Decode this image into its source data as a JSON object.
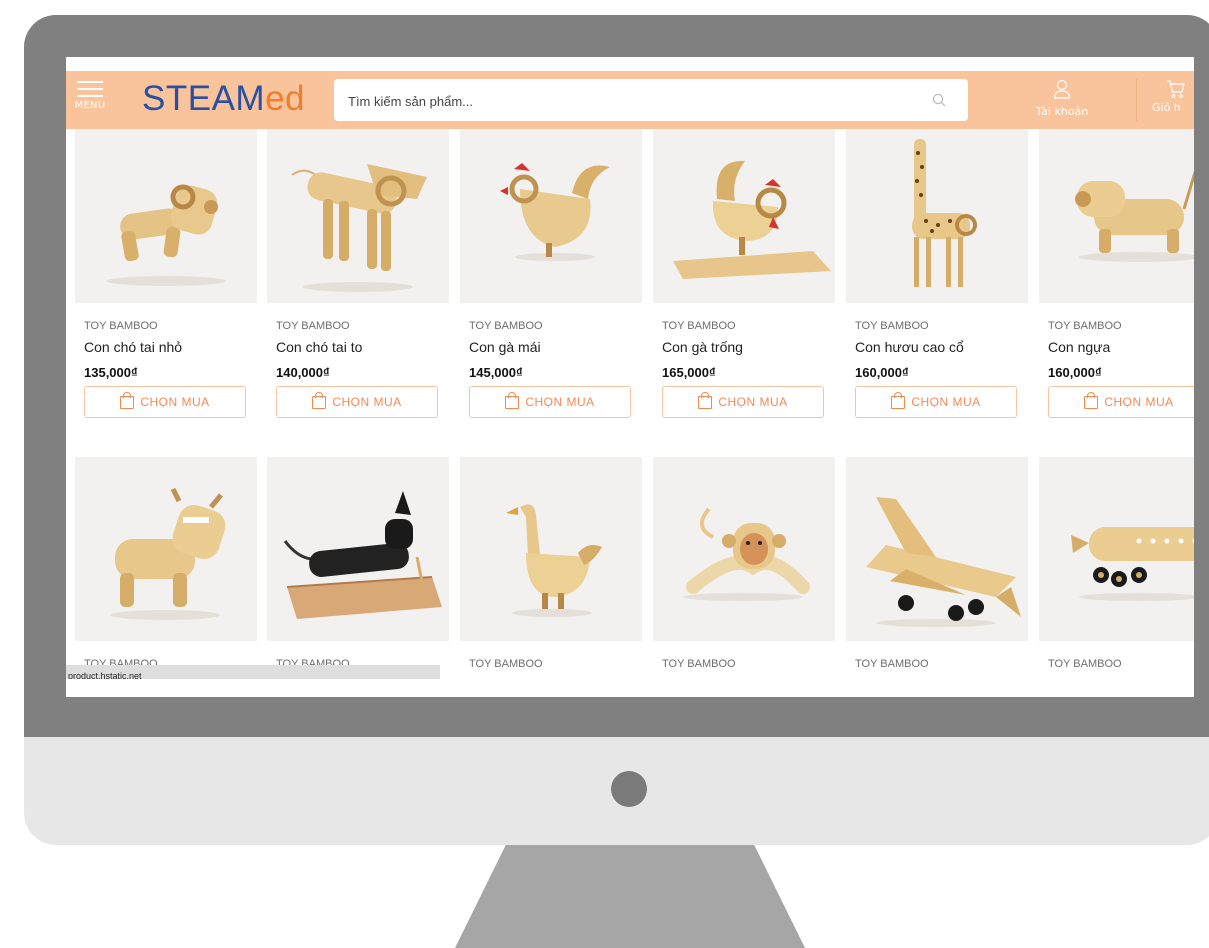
{
  "header": {
    "menu_label": "MENU",
    "logo_main": "STEAM",
    "logo_accent": "ed",
    "search_placeholder": "Tìm kiếm sản phẩm...",
    "account_label": "Tài khoản",
    "cart_label": "Giỏ h"
  },
  "colors": {
    "header_bg": "#f9c49c",
    "logo_blue": "#2b4fa2",
    "logo_orange": "#f07c2c",
    "buy_button_text": "#f28a54",
    "monitor_bezel": "#808080",
    "monitor_chin": "#e7e7e7",
    "monitor_stand": "#a6a6a6"
  },
  "products_row1": [
    {
      "brand": "TOY BAMBOO",
      "name": "Con chó tai nhỏ",
      "price": "135,000₫",
      "button": "CHỌN MUA",
      "image_icon": "bamboo-dog-small-ears"
    },
    {
      "brand": "TOY BAMBOO",
      "name": "Con chó tai to",
      "price": "140,000₫",
      "button": "CHỌN MUA",
      "image_icon": "bamboo-dog-big-ears"
    },
    {
      "brand": "TOY BAMBOO",
      "name": "Con gà mái",
      "price": "145,000₫",
      "button": "CHỌN MUA",
      "image_icon": "bamboo-hen"
    },
    {
      "brand": "TOY BAMBOO",
      "name": "Con gà trống",
      "price": "165,000₫",
      "button": "CHỌN MUA",
      "image_icon": "bamboo-rooster"
    },
    {
      "brand": "TOY BAMBOO",
      "name": "Con hươu cao cổ",
      "price": "160,000₫",
      "button": "CHỌN MUA",
      "image_icon": "bamboo-giraffe"
    },
    {
      "brand": "TOY BAMBOO",
      "name": "Con ngựa",
      "price": "160,000₫",
      "button": "CHỌN MUA",
      "image_icon": "bamboo-horse"
    }
  ],
  "products_row2": [
    {
      "brand": "TOY BAMBOO",
      "image_icon": "bamboo-cow"
    },
    {
      "brand": "TOY BAMBOO",
      "image_icon": "bamboo-black-dachshund"
    },
    {
      "brand": "TOY BAMBOO",
      "image_icon": "bamboo-duck"
    },
    {
      "brand": "TOY BAMBOO",
      "image_icon": "bamboo-monkey"
    },
    {
      "brand": "TOY BAMBOO",
      "image_icon": "bamboo-fighter-jet"
    },
    {
      "brand": "TOY BAMBOO",
      "image_icon": "bamboo-airplane"
    }
  ],
  "status_bar": "product.hstatic.net"
}
